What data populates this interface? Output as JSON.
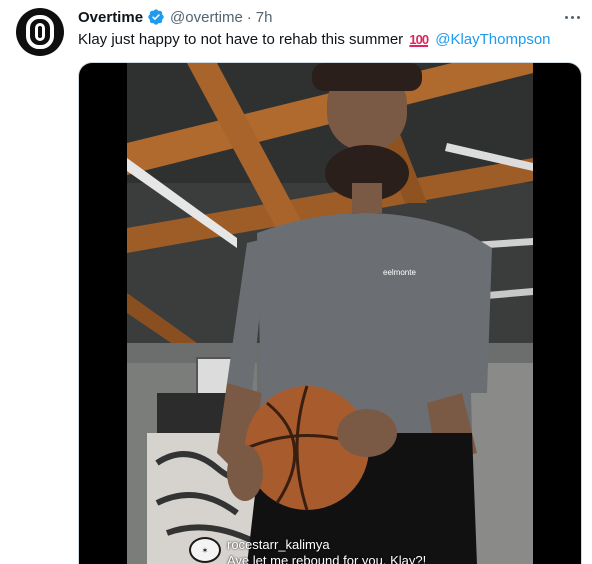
{
  "tweet": {
    "author_name": "Overtime",
    "handle": "@overtime",
    "separator": "·",
    "time": "7h",
    "text_before": "Klay just happy to not have to rehab this summer",
    "emoji": "100",
    "mention": "@KlayThompson",
    "icons": {
      "avatar": "overtime-logo",
      "verified": "verified-badge-icon",
      "more": "more-options-icon"
    },
    "colors": {
      "accent": "#1d9bf0",
      "text": "#0f1419",
      "muted": "#536471"
    }
  },
  "media": {
    "type": "video",
    "overlay": {
      "username": "rocestarr_kalimya",
      "comment": "Aye let me rebound for you, Klay?!"
    },
    "shirt_logo": "eelmonte"
  }
}
